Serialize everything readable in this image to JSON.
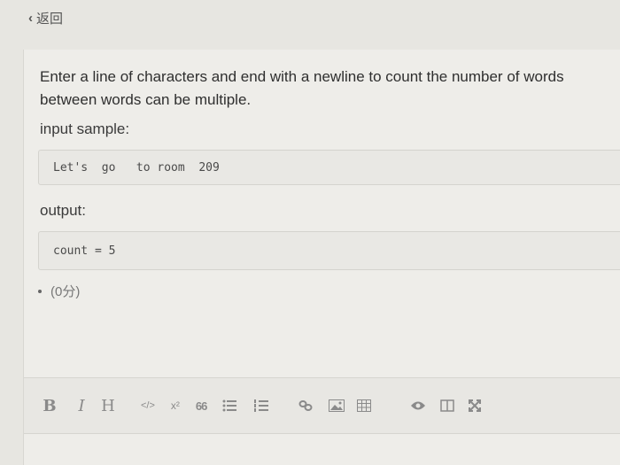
{
  "nav": {
    "back_label": "返回"
  },
  "question": {
    "text_line1": "Enter a line of characters and end with a newline to count the number of words",
    "text_line2": "between words can be multiple.",
    "input_label": "input sample:",
    "input_sample": "Let's  go   to room  209",
    "output_label": "output:",
    "output_sample": "count = 5",
    "score": "(0分)"
  },
  "toolbar": {
    "bold": "B",
    "italic": "I",
    "heading": "H",
    "code": "</>",
    "superscript": "x²",
    "quote": "66",
    "icons": [
      "bold-icon",
      "italic-icon",
      "heading-icon",
      "code-icon",
      "superscript-icon",
      "quote-icon",
      "bulleted-list-icon",
      "numbered-list-icon",
      "link-icon",
      "image-icon",
      "table-icon",
      "preview-eye-icon",
      "split-view-icon",
      "fullscreen-icon"
    ]
  },
  "colors": {
    "background": "#e7e6e1",
    "text": "#2f2f2f",
    "icon": "#8a8a8a"
  }
}
